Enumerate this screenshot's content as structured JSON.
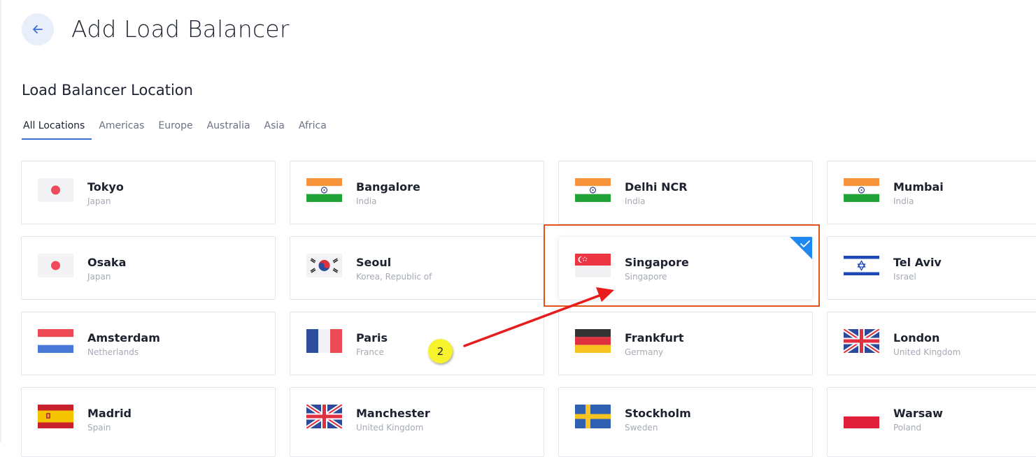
{
  "header": {
    "title": "Add Load Balancer",
    "back_icon": "arrow-left-icon"
  },
  "section": {
    "title": "Load Balancer Location"
  },
  "tabs": [
    {
      "label": "All Locations",
      "active": true
    },
    {
      "label": "Americas",
      "active": false
    },
    {
      "label": "Europe",
      "active": false
    },
    {
      "label": "Australia",
      "active": false
    },
    {
      "label": "Asia",
      "active": false
    },
    {
      "label": "Africa",
      "active": false
    }
  ],
  "locations": [
    {
      "city": "Tokyo",
      "country": "Japan",
      "flag": "japan-flag-icon",
      "selected": false
    },
    {
      "city": "Bangalore",
      "country": "India",
      "flag": "india-flag-icon",
      "selected": false
    },
    {
      "city": "Delhi NCR",
      "country": "India",
      "flag": "india-flag-icon",
      "selected": false
    },
    {
      "city": "Mumbai",
      "country": "India",
      "flag": "india-flag-icon",
      "selected": false
    },
    {
      "city": "Osaka",
      "country": "Japan",
      "flag": "japan-flag-icon",
      "selected": false
    },
    {
      "city": "Seoul",
      "country": "Korea, Republic of",
      "flag": "south-korea-flag-icon",
      "selected": false
    },
    {
      "city": "Singapore",
      "country": "Singapore",
      "flag": "singapore-flag-icon",
      "selected": true
    },
    {
      "city": "Tel Aviv",
      "country": "Israel",
      "flag": "israel-flag-icon",
      "selected": false
    },
    {
      "city": "Amsterdam",
      "country": "Netherlands",
      "flag": "netherlands-flag-icon",
      "selected": false
    },
    {
      "city": "Paris",
      "country": "France",
      "flag": "france-flag-icon",
      "selected": false
    },
    {
      "city": "Frankfurt",
      "country": "Germany",
      "flag": "germany-flag-icon",
      "selected": false
    },
    {
      "city": "London",
      "country": "United Kingdom",
      "flag": "uk-flag-icon",
      "selected": false
    },
    {
      "city": "Madrid",
      "country": "Spain",
      "flag": "spain-flag-icon",
      "selected": false
    },
    {
      "city": "Manchester",
      "country": "United Kingdom",
      "flag": "uk-flag-icon",
      "selected": false
    },
    {
      "city": "Stockholm",
      "country": "Sweden",
      "flag": "sweden-flag-icon",
      "selected": false
    },
    {
      "city": "Warsaw",
      "country": "Poland",
      "flag": "poland-flag-icon",
      "selected": false
    }
  ],
  "annotation": {
    "step_label": "2",
    "highlight_color": "#e2551a",
    "arrow_color": "#e81c1c",
    "badge_color": "#f6f22b"
  },
  "colors": {
    "accent": "#3c6fd2",
    "selected_corner": "#1e88f0"
  }
}
